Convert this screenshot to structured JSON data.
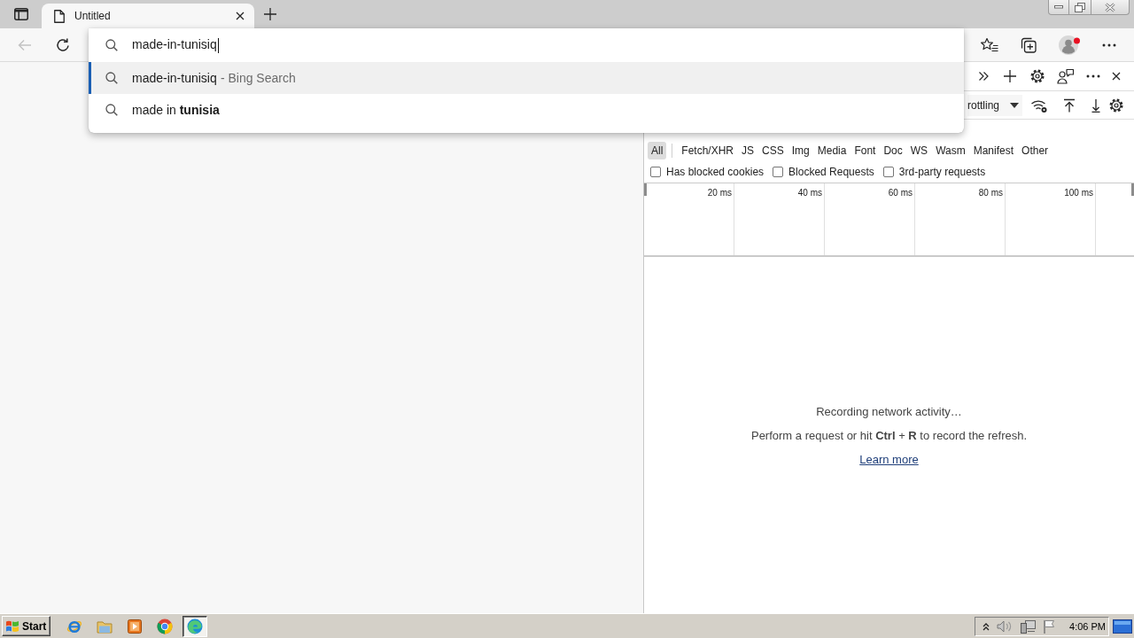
{
  "tabs": [
    {
      "title": "Untitled",
      "selected": true
    }
  ],
  "toolbar": {
    "back": {
      "disabled": true
    }
  },
  "omnibox": {
    "value": "made-in-tunisiq",
    "suggestions": [
      {
        "text": "made-in-tunisiq",
        "suffix": "- Bing Search",
        "selected": true
      },
      {
        "text": "made in **tunisia**",
        "selected": false
      }
    ]
  },
  "devtools": {
    "throttling": "rottling",
    "type_filters": [
      {
        "label": "All",
        "selected": true
      },
      {
        "label": "Fetch/XHR",
        "selected": false
      },
      {
        "label": "JS",
        "selected": false
      },
      {
        "label": "CSS",
        "selected": false
      },
      {
        "label": "Img",
        "selected": false
      },
      {
        "label": "Media",
        "selected": false
      },
      {
        "label": "Font",
        "selected": false
      },
      {
        "label": "Doc",
        "selected": false
      },
      {
        "label": "WS",
        "selected": false
      },
      {
        "label": "Wasm",
        "selected": false
      },
      {
        "label": "Manifest",
        "selected": false
      },
      {
        "label": "Other",
        "selected": false
      }
    ],
    "checkboxes": [
      {
        "label": "Has blocked cookies",
        "checked": false
      },
      {
        "label": "Blocked Requests",
        "checked": false
      },
      {
        "label": "3rd-party requests",
        "checked": false
      }
    ],
    "timeline_ticks": [
      "20 ms",
      "40 ms",
      "60 ms",
      "80 ms",
      "100 ms"
    ],
    "empty_state": {
      "title": "Recording network activity…",
      "hint": "Perform a request or hit **Ctrl** + **R** to record the refresh.",
      "link": "Learn more"
    }
  },
  "taskbar": {
    "start": "Start",
    "apps": [
      {
        "kind": "ebrowser",
        "selected": false
      },
      {
        "kind": "folder",
        "selected": false
      },
      {
        "kind": "player",
        "selected": false
      },
      {
        "kind": "wheel",
        "selected": false
      },
      {
        "kind": "swirl",
        "selected": true
      }
    ],
    "clock": "4:06 PM"
  }
}
